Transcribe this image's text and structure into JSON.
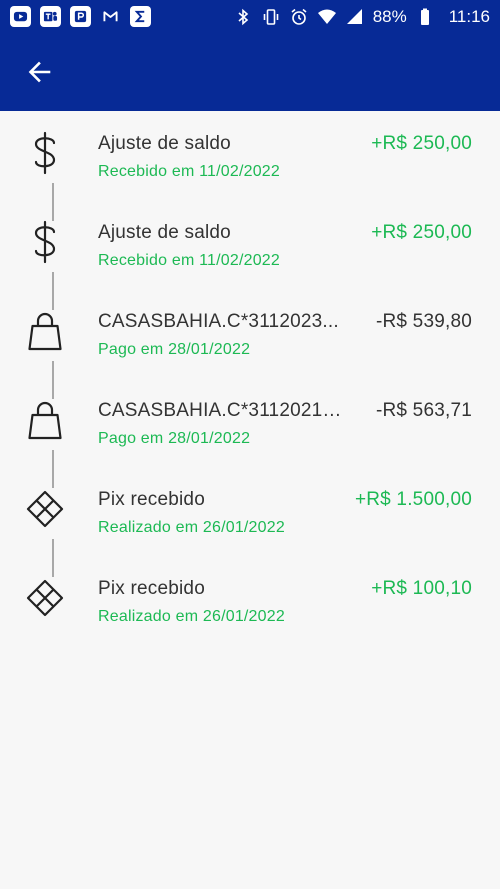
{
  "statusbar": {
    "battery": "88%",
    "time": "11:16",
    "left_icons": [
      "youtube-icon",
      "teams-icon",
      "p-app-icon",
      "gmail-icon",
      "sigma-app-icon"
    ],
    "right_icons": [
      "bluetooth-icon",
      "vibrate-icon",
      "alarm-icon",
      "wifi-icon",
      "signal-icon",
      "battery-icon"
    ]
  },
  "appbar": {
    "back_icon": "arrow-left-icon"
  },
  "colors": {
    "header": "#072a96",
    "positive": "#1db954",
    "text": "#333333"
  },
  "transactions": [
    {
      "icon": "dollar-icon",
      "title": "Ajuste de saldo",
      "subtitle": "Recebido em 11/02/2022",
      "amount": "+R$ 250,00",
      "type": "pos"
    },
    {
      "icon": "dollar-icon",
      "title": "Ajuste de saldo",
      "subtitle": "Recebido em 11/02/2022",
      "amount": "+R$ 250,00",
      "type": "pos"
    },
    {
      "icon": "shopping-bag-icon",
      "title": "CASASBAHIA.C*3112023...",
      "subtitle": "Pago em 28/01/2022",
      "amount": "-R$ 539,80",
      "type": "neg"
    },
    {
      "icon": "shopping-bag-icon",
      "title": "CASASBAHIA.C*31120212...",
      "subtitle": "Pago em 28/01/2022",
      "amount": "-R$ 563,71",
      "type": "neg"
    },
    {
      "icon": "pix-icon",
      "title": "Pix recebido",
      "subtitle": "Realizado em 26/01/2022",
      "amount": "+R$ 1.500,00",
      "type": "pos"
    },
    {
      "icon": "pix-icon",
      "title": "Pix recebido",
      "subtitle": "Realizado em 26/01/2022",
      "amount": "+R$ 100,10",
      "type": "pos"
    }
  ]
}
